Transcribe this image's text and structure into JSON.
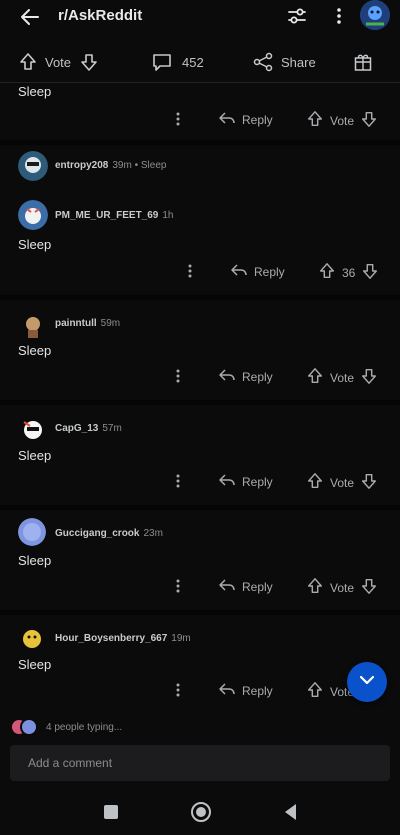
{
  "header": {
    "subreddit": "r/AskReddit"
  },
  "post_actions": {
    "vote_label": "Vote",
    "comments_count": "452",
    "share_label": "Share"
  },
  "comments": [
    {
      "body": "Sleep",
      "reply_label": "Reply",
      "vote_label": "Vote"
    },
    {
      "author": "entropy208",
      "time": "39m • Sleep"
    },
    {
      "author": "PM_ME_UR_FEET_69",
      "time": "1h",
      "body": "Sleep",
      "reply_label": "Reply",
      "vote_label": "36"
    },
    {
      "author": "painntull",
      "time": "59m",
      "body": "Sleep",
      "reply_label": "Reply",
      "vote_label": "Vote"
    },
    {
      "author": "CapG_13",
      "time": "57m",
      "body": "Sleep",
      "reply_label": "Reply",
      "vote_label": "Vote"
    },
    {
      "author": "Guccigang_crook",
      "time": "23m",
      "body": "Sleep",
      "reply_label": "Reply",
      "vote_label": "Vote"
    },
    {
      "author": "Hour_Boysenberry_667",
      "time": "19m",
      "body": "Sleep",
      "reply_label": "Reply",
      "vote_label": "Vote"
    }
  ],
  "typing": {
    "text": "4 people typing..."
  },
  "composer": {
    "placeholder": "Add a comment"
  },
  "colors": {
    "accent": "#0a52cc",
    "background": "#0b0b0b"
  },
  "icons": [
    "back-arrow-icon",
    "sort-icon",
    "more-vertical-icon",
    "upvote-icon",
    "downvote-icon",
    "comment-icon",
    "share-icon",
    "award-icon",
    "reply-icon",
    "chevron-down-icon",
    "recent-apps-icon",
    "home-icon",
    "back-nav-icon"
  ]
}
